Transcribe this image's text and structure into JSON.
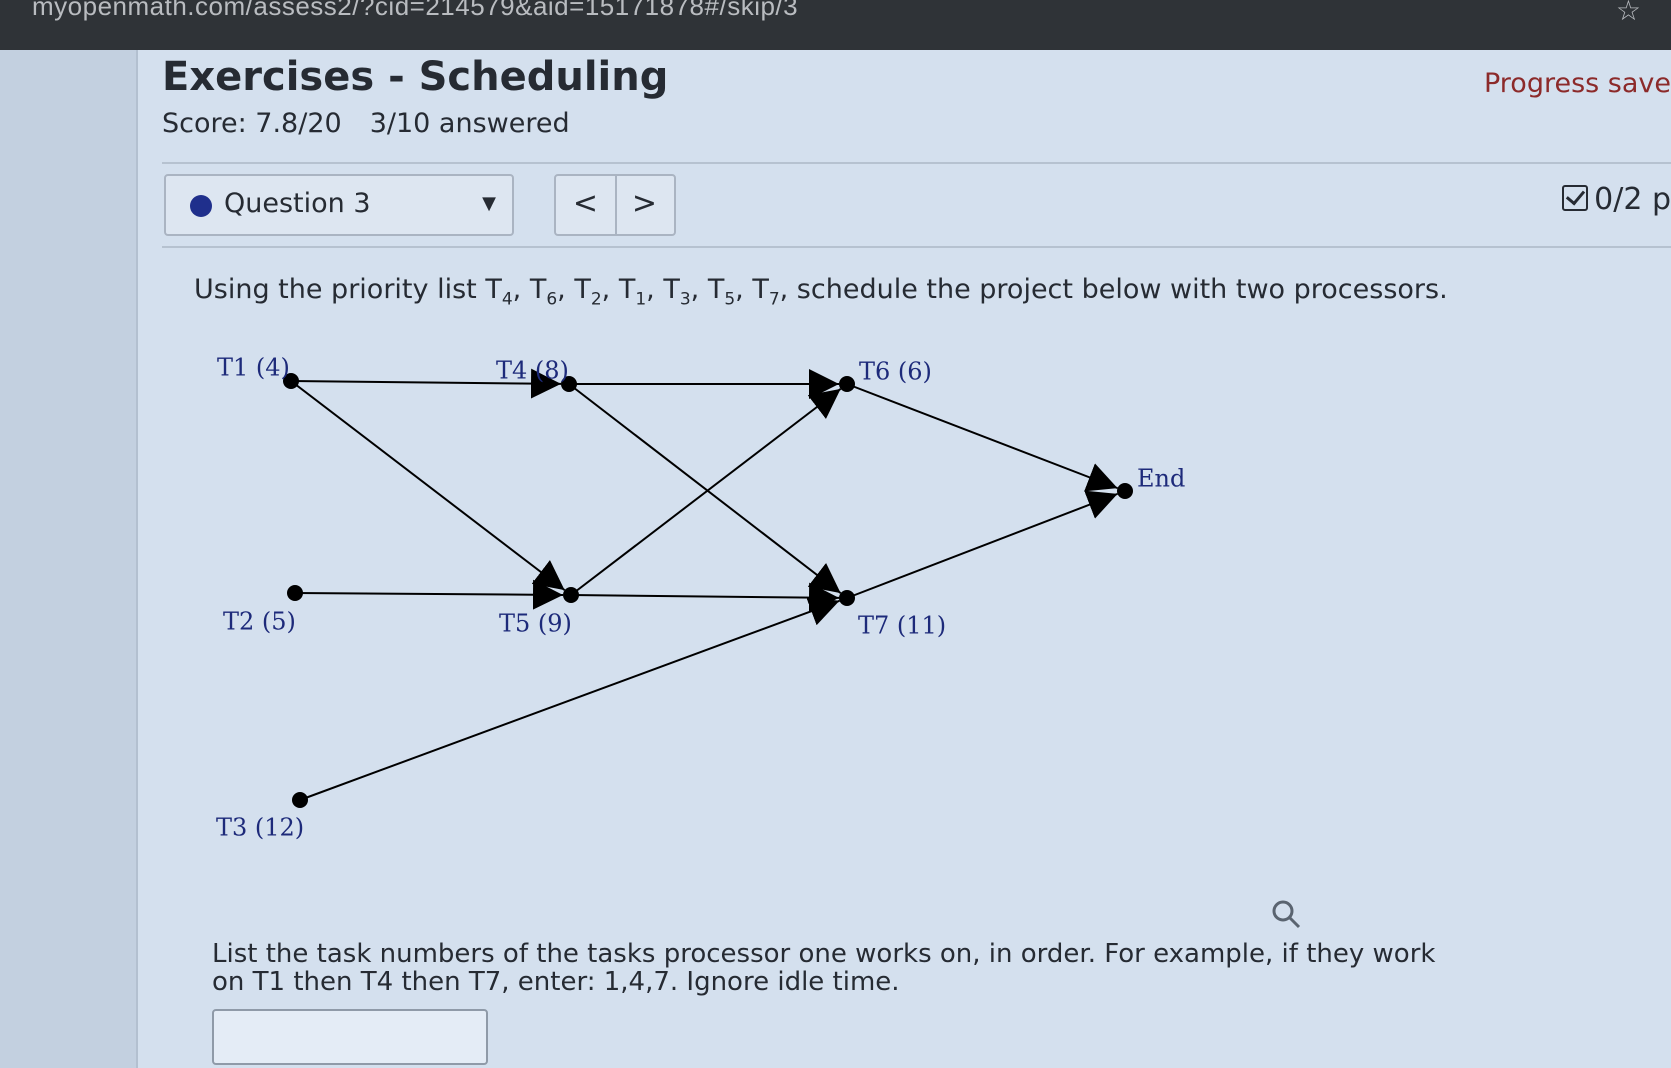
{
  "browser": {
    "url": "myopenmath.com/assess2/?cid=214579&aid=15171878#/skip/3"
  },
  "header": {
    "title": "Exercises - Scheduling",
    "score": "Score: 7.8/20",
    "answered": "3/10 answered",
    "progress": "Progress save"
  },
  "question_nav": {
    "selected": "Question 3",
    "prev_label": "<",
    "next_label": ">",
    "points": "0/2 p"
  },
  "prompt": {
    "prefix": "Using the priority list ",
    "items": [
      {
        "base": "T",
        "sub": "4"
      },
      {
        "base": "T",
        "sub": "6"
      },
      {
        "base": "T",
        "sub": "2"
      },
      {
        "base": "T",
        "sub": "1"
      },
      {
        "base": "T",
        "sub": "3"
      },
      {
        "base": "T",
        "sub": "5"
      },
      {
        "base": "T",
        "sub": "7"
      }
    ],
    "suffix": ", schedule the project below with two processors."
  },
  "graph": {
    "nodes": [
      {
        "id": "T1",
        "label": "T1 (4)"
      },
      {
        "id": "T4",
        "label": "T4 (8)"
      },
      {
        "id": "T6",
        "label": "T6 (6)"
      },
      {
        "id": "End",
        "label": "End"
      },
      {
        "id": "T2",
        "label": "T2 (5)"
      },
      {
        "id": "T5",
        "label": "T5 (9)"
      },
      {
        "id": "T7",
        "label": "T7 (11)"
      },
      {
        "id": "T3",
        "label": "T3 (12)"
      }
    ],
    "edges": [
      {
        "from": "T1",
        "to": "T4"
      },
      {
        "from": "T1",
        "to": "T5"
      },
      {
        "from": "T4",
        "to": "T6"
      },
      {
        "from": "T4",
        "to": "T7"
      },
      {
        "from": "T2",
        "to": "T5"
      },
      {
        "from": "T5",
        "to": "T6"
      },
      {
        "from": "T5",
        "to": "T7"
      },
      {
        "from": "T3",
        "to": "T7"
      },
      {
        "from": "T6",
        "to": "End"
      },
      {
        "from": "T7",
        "to": "End"
      }
    ]
  },
  "instructions": "List the task numbers of the tasks processor one works on, in order. For example, if they work on T1 then T4 then T7, enter: 1,4,7. Ignore idle time.",
  "answer": {
    "value": ""
  },
  "icons": {
    "zoom": "magnifier-icon",
    "star": "bookmark-star-icon",
    "points": "checkbox-icon"
  }
}
